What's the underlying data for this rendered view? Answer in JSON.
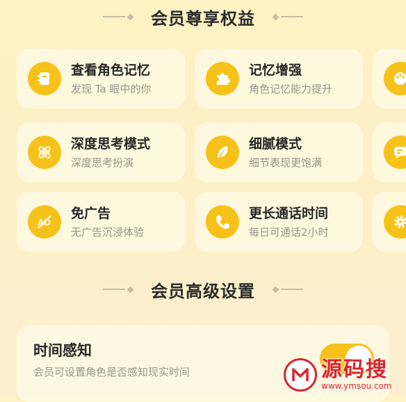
{
  "sections": {
    "benefits_title": "会员尊享权益",
    "settings_title": "会员高级设置"
  },
  "benefits": [
    {
      "title": "查看角色记忆",
      "desc": "发现 Ta 眼中的你",
      "icon": "memory-book-icon"
    },
    {
      "title": "记忆增强",
      "desc": "角色记忆能力提升",
      "icon": "puzzle-icon"
    },
    {
      "title": "",
      "desc": "",
      "icon": "palette-icon"
    },
    {
      "title": "深度思考模式",
      "desc": "深度思考扮演",
      "icon": "atom-icon"
    },
    {
      "title": "细腻模式",
      "desc": "细节表现更饱满",
      "icon": "feather-icon"
    },
    {
      "title": "",
      "desc": "",
      "icon": "chat-bubble-icon"
    },
    {
      "title": "免广告",
      "desc": "无广告沉浸体验",
      "icon": "no-ads-icon"
    },
    {
      "title": "更长通话时间",
      "desc": "每日可通话2小时",
      "icon": "phone-icon"
    },
    {
      "title": "",
      "desc": "",
      "icon": "gear-icon"
    }
  ],
  "settings": {
    "time_awareness": {
      "title": "时间感知",
      "desc": "会员可设置角色是否感知现实时间",
      "enabled": true
    }
  },
  "watermark": {
    "main": "源码搜",
    "sub": "www.ymsou.com"
  },
  "colors": {
    "accent": "#f6c21a",
    "watermark": "#d8262d"
  }
}
